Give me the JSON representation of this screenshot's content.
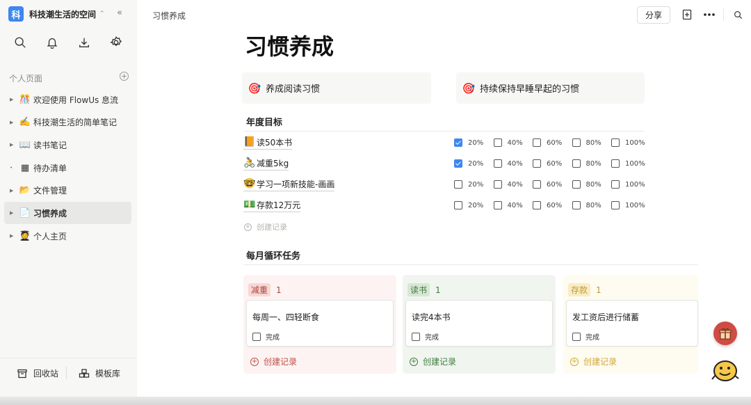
{
  "workspace": {
    "logo_char": "科",
    "name": "科技潮生活的空间",
    "switch_icon": "chevron-updown-icon",
    "collapse_icon": "double-chevron-left-icon"
  },
  "sidebar": {
    "tools": [
      "search-icon",
      "bell-icon",
      "download-icon",
      "gear-icon"
    ],
    "section_title": "个人页面",
    "items": [
      {
        "emoji": "🎊",
        "label": "欢迎使用 FlowUs 息流",
        "expander": "▶"
      },
      {
        "emoji": "✍️",
        "label": "科技潮生活的简单笔记",
        "expander": "▶"
      },
      {
        "emoji": "📖",
        "label": "读书笔记",
        "expander": "▶"
      },
      {
        "emoji": "▦",
        "label": "待办清单",
        "expander": "•"
      },
      {
        "emoji": "📂",
        "label": "文件管理",
        "expander": "▶"
      },
      {
        "emoji": "📄",
        "label": "习惯养成",
        "expander": "▶",
        "active": true
      },
      {
        "emoji": "🧑‍🎓",
        "label": "个人主页",
        "expander": "▶"
      }
    ],
    "bottom": {
      "trash": "回收站",
      "templates": "模板库"
    }
  },
  "header": {
    "breadcrumb": "习惯养成",
    "share": "分享"
  },
  "page": {
    "title": "习惯养成",
    "goal_cards": [
      {
        "emoji": "🎯",
        "label": "养成阅读习惯"
      },
      {
        "emoji": "🎯",
        "label": "持续保持早睡早起的习惯"
      }
    ],
    "annual_heading": "年度目标",
    "goal_levels": [
      "20%",
      "40%",
      "60%",
      "80%",
      "100%"
    ],
    "goals": [
      {
        "emoji": "📙",
        "name": "读50本书",
        "checked": [
          true,
          false,
          false,
          false,
          false
        ]
      },
      {
        "emoji": "🚴",
        "name": "减重5kg",
        "checked": [
          true,
          false,
          false,
          false,
          false
        ]
      },
      {
        "emoji": "🤓",
        "name": "学习一项新技能-画画",
        "checked": [
          false,
          false,
          false,
          false,
          false
        ]
      },
      {
        "emoji": "💵",
        "name": "存款12万元",
        "checked": [
          false,
          false,
          false,
          false,
          false
        ]
      }
    ],
    "create_record": "创建记录",
    "monthly_heading": "每月循环任务",
    "columns": [
      {
        "tag": "减重",
        "count": "1",
        "bg": "#fdf3f2",
        "tag_bg": "#f6d8d5",
        "tag_color": "#b3423a",
        "card_title": "每周一、四轻断食",
        "done_label": "完成",
        "create": "创建记录",
        "create_color": "#c0504a"
      },
      {
        "tag": "读书",
        "count": "1",
        "bg": "#f1f5f0",
        "tag_bg": "#d8e7d5",
        "tag_color": "#3c7a3a",
        "card_title": "读完4本书",
        "done_label": "完成",
        "create": "创建记录",
        "create_color": "#3e7d3d"
      },
      {
        "tag": "存款",
        "count": "1",
        "bg": "#fefbf0",
        "tag_bg": "#f8edc8",
        "tag_color": "#c39a2e",
        "card_title": "发工资后进行储蓄",
        "done_label": "完成",
        "create": "创建记录",
        "create_color": "#d0a83a"
      }
    ]
  },
  "floating": {
    "gift_icon": "gift-icon",
    "mascot_icon": "mascot-icon"
  }
}
